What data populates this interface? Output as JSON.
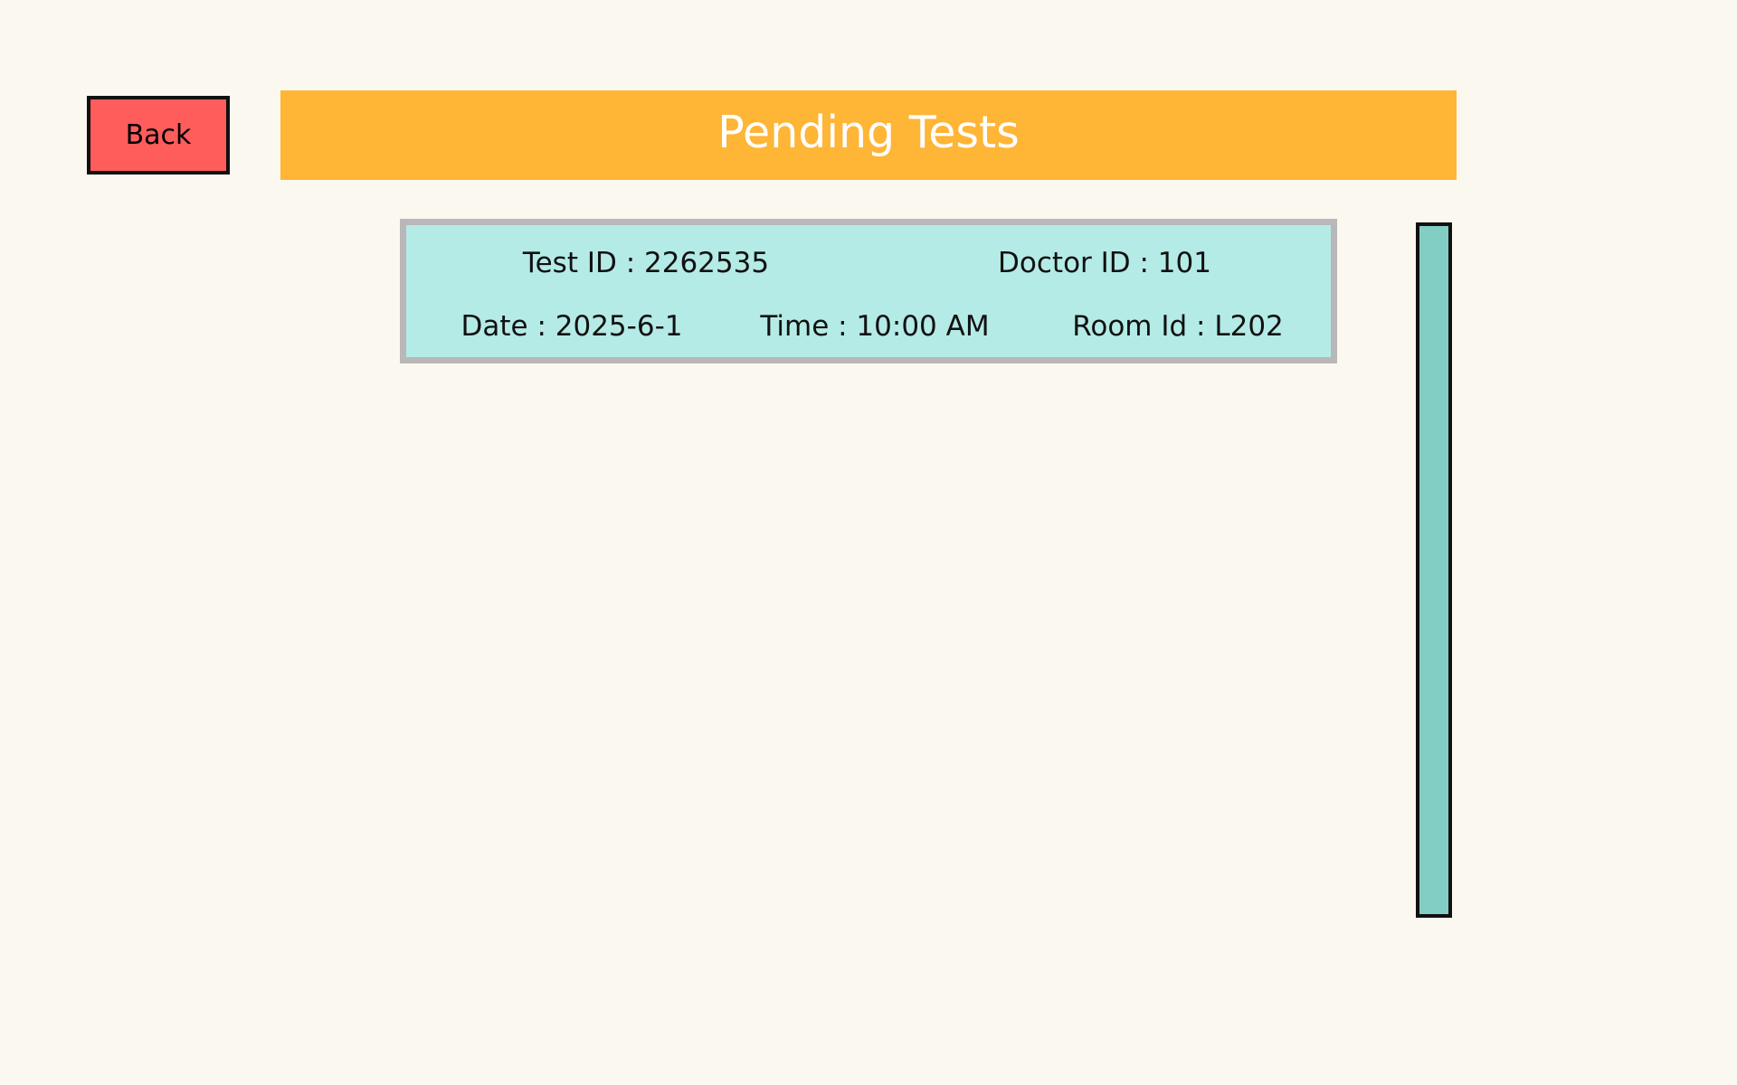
{
  "back_button": {
    "label": "Back"
  },
  "header": {
    "title": "Pending Tests"
  },
  "tests": [
    {
      "test_id": "Test ID : 2262535",
      "doctor_id": "Doctor ID : 101",
      "date": "Date : 2025-6-1",
      "time": "Time : 10:00 AM",
      "room_id": "Room Id : L202"
    }
  ],
  "colors": {
    "background": "#fbf8f0",
    "back_button": "#ff5c5c",
    "header": "#ffb535",
    "card": "#b4ebe6",
    "card_border": "#b9b7b7",
    "scrollbar": "#82cdc4"
  }
}
